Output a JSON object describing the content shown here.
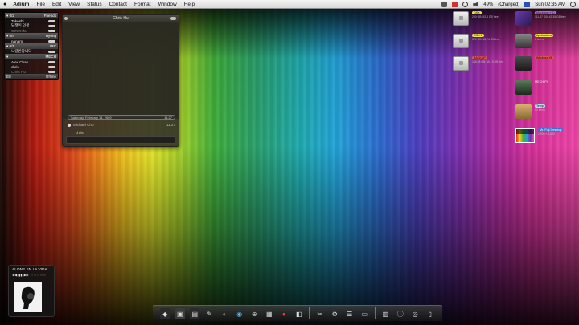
{
  "menubar": {
    "apple": "",
    "app_name": "Adium",
    "items": [
      "File",
      "Edit",
      "View",
      "Status",
      "Contact",
      "Format",
      "Window",
      "Help"
    ],
    "battery": "49%",
    "clock": "Sun 02:35 AM",
    "charge": "(Charged)"
  },
  "contacts": {
    "groups": [
      {
        "name": "Friends",
        "count": "0/2",
        "rows": [
          {
            "name": "Takeshi",
            "away": false
          },
          {
            "name": "담쟁이 인생",
            "away": false
          },
          {
            "name": "steven ko",
            "away": true
          }
        ]
      },
      {
        "name": "Hyong",
        "count": "0/4",
        "rows": [
          {
            "name": "nanami",
            "away": false
          }
        ]
      },
      {
        "name": "IRC",
        "count": "0/1",
        "rows": [
          {
            "name": "노랑반장너다",
            "away": false
          }
        ]
      },
      {
        "name": "MECH",
        "count": "",
        "rows": [
          {
            "name": "Alex Chan",
            "away": false
          },
          {
            "name": "chris",
            "away": false
          },
          {
            "name": "Chris Hu",
            "away": true
          }
        ]
      }
    ],
    "footer_left": "E8",
    "footer_status": "Offline"
  },
  "chat": {
    "title": "Chris Hu",
    "date_label": "Saturday, February 14, 2009",
    "date_time": "11:27",
    "sender": "Michael Cho",
    "msg_time": "11:27",
    "text": "chris"
  },
  "desktop": {
    "drives": [
      {
        "badge": "OSX",
        "info": "200 GB, 92.4 GB free",
        "badge_color": "#f0e040"
      },
      {
        "badge": "OSX B",
        "info": "320 GB, 15.74 GB free",
        "badge_color": "#f0e040"
      },
      {
        "badge": "BACKUP",
        "info": "145.28 GB, 45.19 GB free",
        "badge_color": "#e05050"
      }
    ],
    "items": [
      {
        "badge": "Macintosh HD",
        "info": "111.47 GB, 43.35 GB free",
        "badge_color": "#b070e0"
      },
      {
        "badge": "Applications",
        "info": "6 items",
        "badge_color": "#f0e040"
      },
      {
        "badge": "Windows XP",
        "info": "",
        "badge_color": "#e05050"
      },
      {
        "badge": "MECH PX",
        "info": "",
        "badge_color": ""
      },
      {
        "badge": "Temp",
        "info": "54 items",
        "badge_color": "#b0e0f0"
      },
      {
        "badge": "Mr. Fuji Desktop",
        "info": "1,920 × 1,080",
        "badge_color": ""
      }
    ]
  },
  "music": {
    "title": "ALONE EN LA VIDA",
    "prev": "◀◀",
    "play": "▮▮",
    "next": "▶▶",
    "stars": "☆☆☆☆☆"
  }
}
